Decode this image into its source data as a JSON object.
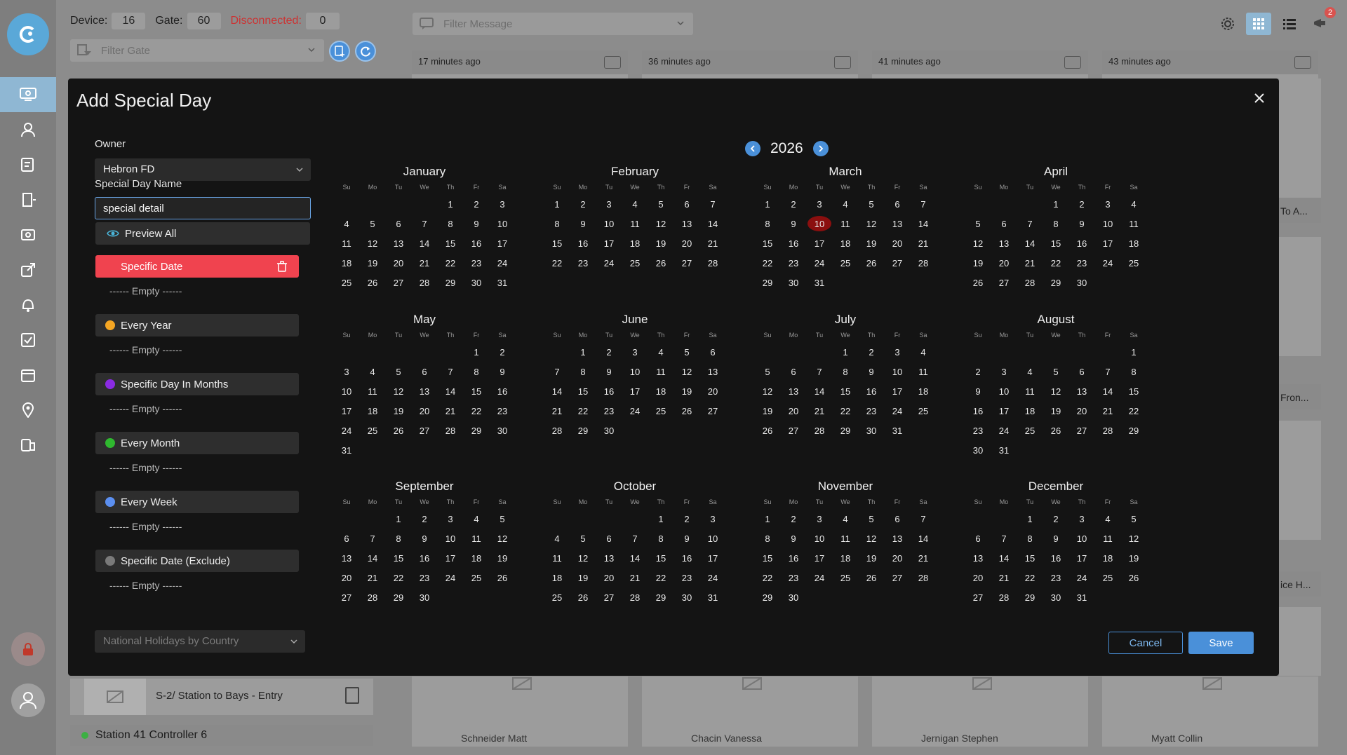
{
  "header": {
    "device_label": "Device:",
    "device_value": "16",
    "gate_label": "Gate:",
    "gate_value": "60",
    "disconnected_label": "Disconnected:",
    "disconnected_value": "0",
    "filter_gate_placeholder": "Filter Gate",
    "filter_message_placeholder": "Filter Message",
    "notification_count": "2"
  },
  "background": {
    "cards": [
      "17 minutes ago",
      "36 minutes ago",
      "41 minutes ago",
      "43 minutes ago"
    ],
    "side_texts": [
      "To A...",
      "Fron...",
      "ice H..."
    ],
    "bottom_names": [
      "Schneider Matt",
      "Chacin Vanessa",
      "Jernigan Stephen",
      "Myatt Collin"
    ],
    "left_row_text": "S-2/ Station to Bays - Entry",
    "left_controller": "Station 41 Controller 6"
  },
  "modal": {
    "title": "Add Special Day",
    "owner_label": "Owner",
    "owner_value": "Hebron FD",
    "name_label": "Special Day Name",
    "name_value": "special detail",
    "preview_label": "Preview All",
    "empty_text": "------ Empty ------",
    "categories": [
      {
        "label": "Specific Date",
        "color": "#f0434f"
      },
      {
        "label": "Every Year",
        "color": "#f5a623"
      },
      {
        "label": "Specific Day In Months",
        "color": "#8a2be2"
      },
      {
        "label": "Every Month",
        "color": "#2fb82f"
      },
      {
        "label": "Every Week",
        "color": "#5b8ff0"
      },
      {
        "label": "Specific Date (Exclude)",
        "color": "#7a7a7a"
      }
    ],
    "holiday_placeholder": "National Holidays by Country",
    "cancel_label": "Cancel",
    "save_label": "Save"
  },
  "calendar": {
    "year": "2026",
    "weekdays": [
      "Su",
      "Mo",
      "Tu",
      "We",
      "Th",
      "Fr",
      "Sa"
    ],
    "today": {
      "month": 2,
      "day": 10
    },
    "months": [
      {
        "name": "January",
        "start": 4,
        "days": 31
      },
      {
        "name": "February",
        "start": 0,
        "days": 28
      },
      {
        "name": "March",
        "start": 0,
        "days": 31
      },
      {
        "name": "April",
        "start": 3,
        "days": 30
      },
      {
        "name": "May",
        "start": 5,
        "days": 31
      },
      {
        "name": "June",
        "start": 1,
        "days": 30
      },
      {
        "name": "July",
        "start": 3,
        "days": 31
      },
      {
        "name": "August",
        "start": 6,
        "days": 31
      },
      {
        "name": "September",
        "start": 2,
        "days": 30
      },
      {
        "name": "October",
        "start": 4,
        "days": 31
      },
      {
        "name": "November",
        "start": 0,
        "days": 30
      },
      {
        "name": "December",
        "start": 2,
        "days": 31
      }
    ]
  },
  "colors": {
    "accent": "#4a90d9",
    "danger": "#f0434f",
    "today": "#8b0f0f"
  }
}
